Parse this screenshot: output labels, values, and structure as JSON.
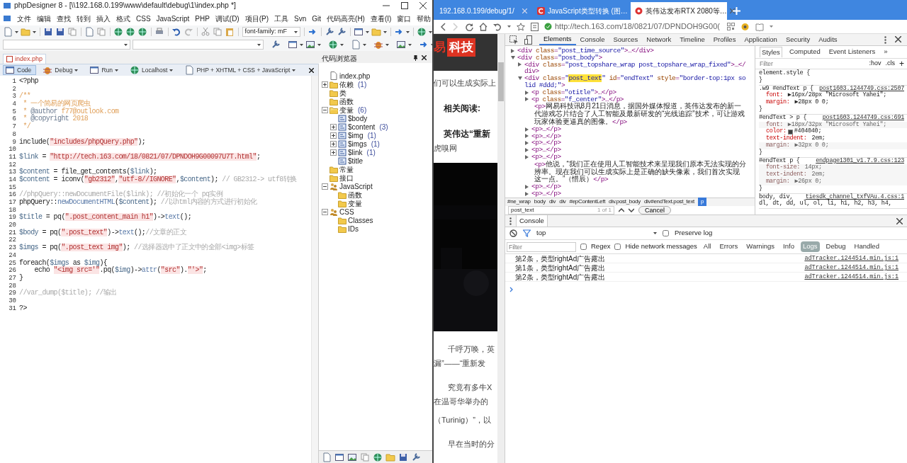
{
  "editor_window": {
    "title": "phpDesigner 8 - [\\\\192.168.0.199\\www\\default\\debug\\1\\index.php *]",
    "menu": [
      "文件",
      "编辑",
      "查找",
      "转到",
      "插入",
      "格式",
      "CSS",
      "JavaScript",
      "PHP",
      "调试(D)",
      "项目(P)",
      "工具",
      "Svn",
      "Git",
      "代码高亮(H)",
      "查看(I)",
      "窗口",
      "帮助"
    ],
    "font_combo": "font-family: mF",
    "file_tabs": [
      {
        "label": "index.php",
        "selected": true
      }
    ],
    "run_toolbar": [
      {
        "label": "Code",
        "selected": true,
        "dropdown": false
      },
      {
        "label": "Debug",
        "selected": false,
        "dropdown": true
      },
      {
        "label": "Run",
        "selected": false,
        "dropdown": true
      },
      {
        "label": "Localhost",
        "selected": false,
        "dropdown": true
      },
      {
        "label": "PHP + XHTML + CSS + JavaScript",
        "selected": false,
        "dropdown": true
      }
    ],
    "code_lines": [
      {
        "number": "1",
        "tokens": [
          {
            "kind": "plain",
            "text": "<?php"
          }
        ]
      },
      {
        "number": "2"
      },
      {
        "number": "3",
        "tokens": [
          {
            "kind": "doc",
            "text": "/**"
          }
        ]
      },
      {
        "number": "4",
        "tokens": [
          {
            "kind": "doc",
            "text": " * 一个简易的网页爬虫"
          }
        ]
      },
      {
        "number": "5",
        "tokens": [
          {
            "kind": "doc",
            "text": " * "
          },
          {
            "kind": "doctag",
            "text": "@author"
          },
          {
            "kind": "doc",
            "text": " f77@outlook.com"
          }
        ]
      },
      {
        "number": "6",
        "tokens": [
          {
            "kind": "doc",
            "text": " * "
          },
          {
            "kind": "doctag",
            "text": "@copyright"
          },
          {
            "kind": "doc",
            "text": " 2018"
          }
        ]
      },
      {
        "number": "7",
        "tokens": [
          {
            "kind": "doc",
            "text": " */"
          }
        ]
      },
      {
        "number": "8"
      },
      {
        "number": "9",
        "tokens": [
          {
            "kind": "plain",
            "text": "include("
          },
          {
            "kind": "string",
            "text": "\"includes/phpQuery.php\""
          },
          {
            "kind": "plain",
            "text": ");"
          }
        ]
      },
      {
        "number": "10"
      },
      {
        "number": "11",
        "tokens": [
          {
            "kind": "var",
            "text": "$link"
          },
          {
            "kind": "plain",
            "text": " = "
          },
          {
            "kind": "string",
            "text": "\"http://tech.163.com/18/0821/07/DPNDOH9G00097U7T.html\""
          },
          {
            "kind": "plain",
            "text": ";"
          }
        ]
      },
      {
        "number": "12"
      },
      {
        "number": "13",
        "tokens": [
          {
            "kind": "var",
            "text": "$content"
          },
          {
            "kind": "plain",
            "text": " = file_get_contents("
          },
          {
            "kind": "var",
            "text": "$link"
          },
          {
            "kind": "plain",
            "text": ");"
          }
        ]
      },
      {
        "number": "14",
        "tokens": [
          {
            "kind": "var",
            "text": "$content"
          },
          {
            "kind": "plain",
            "text": " = iconv("
          },
          {
            "kind": "string",
            "text": "\"gb2312\""
          },
          {
            "kind": "plain",
            "text": ","
          },
          {
            "kind": "string",
            "text": "\"utf-8//IGNORE\""
          },
          {
            "kind": "plain",
            "text": ","
          },
          {
            "kind": "var",
            "text": "$content"
          },
          {
            "kind": "plain",
            "text": ");"
          },
          {
            "kind": "comment",
            "text": " // GB2312-> utf8转换"
          }
        ]
      },
      {
        "number": "15"
      },
      {
        "number": "16",
        "tokens": [
          {
            "kind": "comment",
            "text": "//phpQuery::newDocumentFile($link); //初始化一个 pq实例"
          }
        ]
      },
      {
        "number": "17",
        "tokens": [
          {
            "kind": "plain",
            "text": "phpQuery::"
          },
          {
            "kind": "method",
            "text": "newDocumentHTML"
          },
          {
            "kind": "plain",
            "text": "("
          },
          {
            "kind": "var",
            "text": "$content"
          },
          {
            "kind": "plain",
            "text": ");"
          },
          {
            "kind": "comment",
            "text": " //以html内容的方式进行初始化"
          }
        ]
      },
      {
        "number": "18"
      },
      {
        "number": "19",
        "tokens": [
          {
            "kind": "var",
            "text": "$title"
          },
          {
            "kind": "plain",
            "text": " = pq("
          },
          {
            "kind": "string",
            "text": "\".post_content_main h1\""
          },
          {
            "kind": "plain",
            "text": ")->"
          },
          {
            "kind": "method",
            "text": "text"
          },
          {
            "kind": "plain",
            "text": "();"
          }
        ]
      },
      {
        "number": "20"
      },
      {
        "number": "21",
        "tokens": [
          {
            "kind": "var",
            "text": "$body"
          },
          {
            "kind": "plain",
            "text": " = pq("
          },
          {
            "kind": "string",
            "text": "\".post_text\""
          },
          {
            "kind": "plain",
            "text": ")->"
          },
          {
            "kind": "method",
            "text": "text"
          },
          {
            "kind": "plain",
            "text": "();"
          },
          {
            "kind": "comment",
            "text": "//文章的正文"
          }
        ]
      },
      {
        "number": "22"
      },
      {
        "number": "23",
        "tokens": [
          {
            "kind": "var",
            "text": "$imgs"
          },
          {
            "kind": "plain",
            "text": " = pq("
          },
          {
            "kind": "string",
            "text": "\".post_text img\""
          },
          {
            "kind": "plain",
            "text": ");"
          },
          {
            "kind": "comment",
            "text": " //选择器选中了正文中的全部<img>标签"
          }
        ]
      },
      {
        "number": "24"
      },
      {
        "number": "25",
        "tokens": [
          {
            "kind": "plain",
            "text": "foreach("
          },
          {
            "kind": "var",
            "text": "$imgs"
          },
          {
            "kind": "plain",
            "text": " as "
          },
          {
            "kind": "var",
            "text": "$img"
          },
          {
            "kind": "plain",
            "text": "){"
          }
        ]
      },
      {
        "number": "26",
        "tokens": [
          {
            "kind": "plain",
            "text": "    echo "
          },
          {
            "kind": "string",
            "text": "\"<img src='\""
          },
          {
            "kind": "plain",
            "text": ".pq("
          },
          {
            "kind": "var",
            "text": "$img"
          },
          {
            "kind": "plain",
            "text": ")->"
          },
          {
            "kind": "method",
            "text": "attr"
          },
          {
            "kind": "plain",
            "text": "("
          },
          {
            "kind": "string",
            "text": "\"src\""
          },
          {
            "kind": "plain",
            "text": ")."
          },
          {
            "kind": "string",
            "text": "\"'>\""
          },
          {
            "kind": "plain",
            "text": ";"
          }
        ]
      },
      {
        "number": "27",
        "tokens": [
          {
            "kind": "plain",
            "text": "}"
          }
        ]
      },
      {
        "number": "28"
      },
      {
        "number": "29",
        "tokens": [
          {
            "kind": "comment",
            "text": "//var_dump($title); //输出"
          }
        ]
      },
      {
        "number": "30"
      },
      {
        "number": "31",
        "tokens": [
          {
            "kind": "plain",
            "text": "?>"
          }
        ]
      }
    ],
    "code_browser": {
      "title": "代码浏览器",
      "tree": [
        {
          "label": "index.php",
          "kind": "file"
        },
        {
          "label": "依赖",
          "count": "(1)",
          "kind": "folder",
          "expanded": false
        },
        {
          "label": "类",
          "kind": "folder"
        },
        {
          "label": "函数",
          "kind": "folder"
        },
        {
          "label": "变量",
          "count": "(6)",
          "kind": "folder",
          "expanded": true,
          "children": [
            {
              "label": "$body",
              "kind": "var"
            },
            {
              "label": "$content",
              "count": "(3)",
              "kind": "var",
              "expanded": false
            },
            {
              "label": "$img",
              "count": "(1)",
              "kind": "var",
              "expanded": false
            },
            {
              "label": "$imgs",
              "count": "(1)",
              "kind": "var",
              "expanded": false
            },
            {
              "label": "$link",
              "count": "(1)",
              "kind": "var",
              "expanded": false
            },
            {
              "label": "$title",
              "kind": "var"
            }
          ]
        },
        {
          "label": "常量",
          "kind": "folder"
        },
        {
          "label": "接口",
          "kind": "folder"
        },
        {
          "label": "JavaScript",
          "kind": "group",
          "expanded": true,
          "children": [
            {
              "label": "函数",
              "kind": "folder"
            },
            {
              "label": "变量",
              "kind": "folder"
            }
          ]
        },
        {
          "label": "CSS",
          "kind": "group",
          "expanded": true,
          "children": [
            {
              "label": "Classes",
              "kind": "folder"
            },
            {
              "label": "IDs",
              "kind": "folder"
            }
          ]
        }
      ]
    }
  },
  "browser": {
    "tabs": [
      {
        "label": "192.168.0.199/debug/1/",
        "selected": false
      },
      {
        "label": "JavaScript类型转换 (图…",
        "selected": false
      },
      {
        "label": "英伟达发布RTX 2080等…",
        "selected": true
      }
    ],
    "url": "http://tech.163.com/18/0821/07/DPNDOH9G00(",
    "page": {
      "logo_text": "易",
      "logo_badge": "科技",
      "blocks": [
        {
          "kind": "text",
          "text": "们可以生成实际上"
        },
        {
          "kind": "bold",
          "text": "相关阅读:"
        },
        {
          "kind": "bold",
          "text": "英伟达“重新"
        },
        {
          "kind": "text",
          "text": "虎嗅网"
        },
        {
          "kind": "video"
        },
        {
          "kind": "indent",
          "text": "千呼万唤，英"
        },
        {
          "kind": "text",
          "text": "漏”——“重新发"
        },
        {
          "kind": "indent",
          "text": "究竟有多牛X"
        },
        {
          "kind": "text",
          "text": "在温哥华举办的"
        },
        {
          "kind": "text",
          "text": "（Turinig）”，以"
        },
        {
          "kind": "indent",
          "text": "早在当时的分"
        }
      ]
    }
  },
  "devtools": {
    "tabs": [
      {
        "label": "Elements",
        "selected": true
      },
      {
        "label": "Console",
        "selected": false
      },
      {
        "label": "Sources",
        "selected": false
      },
      {
        "label": "Network",
        "selected": false
      },
      {
        "label": "Timeline",
        "selected": false
      },
      {
        "label": "Profiles",
        "selected": false
      },
      {
        "label": "Application",
        "selected": false
      },
      {
        "label": "Security",
        "selected": false
      },
      {
        "label": "Audits",
        "selected": false
      }
    ],
    "dom_tree": [
      {
        "tokens": [
          {
            "kind": "tag",
            "text": "<div "
          },
          {
            "kind": "attr",
            "text": "class"
          },
          {
            "kind": "tag",
            "text": "="
          },
          {
            "kind": "value",
            "text": "\"post_time_source\""
          },
          {
            "kind": "tag",
            "text": ">…</div>"
          }
        ],
        "expanded": false
      },
      {
        "tokens": [
          {
            "kind": "tag",
            "text": "<div "
          },
          {
            "kind": "attr",
            "text": "class"
          },
          {
            "kind": "tag",
            "text": "="
          },
          {
            "kind": "value",
            "text": "\"post_body\""
          },
          {
            "kind": "tag",
            "text": ">"
          }
        ],
        "expanded": true,
        "children": [
          {
            "tokens": [
              {
                "kind": "tag",
                "text": "<div "
              },
              {
                "kind": "attr",
                "text": "class"
              },
              {
                "kind": "tag",
                "text": "="
              },
              {
                "kind": "value",
                "text": "\"post_topshare_wrap post_topshare_wrap_fixed\""
              },
              {
                "kind": "tag",
                "text": ">…</div>"
              }
            ],
            "expanded": false
          },
          {
            "tokens": [
              {
                "kind": "tag",
                "text": "<div "
              },
              {
                "kind": "attr",
                "text": "class"
              },
              {
                "kind": "tag",
                "text": "="
              },
              {
                "kind": "value",
                "text": "\""
              },
              {
                "kind": "match",
                "text": "post_text"
              },
              {
                "kind": "value",
                "text": "\""
              },
              {
                "kind": "attr",
                "text": " id"
              },
              {
                "kind": "tag",
                "text": "="
              },
              {
                "kind": "value",
                "text": "\"endText\""
              },
              {
                "kind": "attr",
                "text": " style"
              },
              {
                "kind": "tag",
                "text": "="
              },
              {
                "kind": "value",
                "text": "\"border-top:1px solid #ddd;\""
              },
              {
                "kind": "tag",
                "text": ">"
              }
            ],
            "expanded": true,
            "children": [
              {
                "tokens": [
                  {
                    "kind": "tag",
                    "text": "<p "
                  },
                  {
                    "kind": "attr",
                    "text": "class"
                  },
                  {
                    "kind": "tag",
                    "text": "="
                  },
                  {
                    "kind": "value",
                    "text": "\"otitle\""
                  },
                  {
                    "kind": "tag",
                    "text": ">…</p>"
                  }
                ],
                "expanded": false
              },
              {
                "tokens": [
                  {
                    "kind": "tag",
                    "text": "<p "
                  },
                  {
                    "kind": "attr",
                    "text": "class"
                  },
                  {
                    "kind": "tag",
                    "text": "="
                  },
                  {
                    "kind": "value",
                    "text": "\"f_center\""
                  },
                  {
                    "kind": "tag",
                    "text": ">…</p>"
                  }
                ],
                "expanded": false
              },
              {
                "tokens": [
                  {
                    "kind": "tag",
                    "text": "<p>"
                  },
                  {
                    "kind": "text",
                    "text": "网易科技讯8月21日消息，据国外媒体报道，英伟达发布的新一代游戏芯片结合了人工智能及最新研发的“光线追踪”技术，可让游戏玩家体验更逼真的图像。"
                  },
                  {
                    "kind": "tag",
                    "text": "</p>"
                  }
                ]
              },
              {
                "tokens": [
                  {
                    "kind": "tag",
                    "text": "<p>…</p>"
                  }
                ],
                "expanded": false
              },
              {
                "tokens": [
                  {
                    "kind": "tag",
                    "text": "<p>…</p>"
                  }
                ],
                "expanded": false
              },
              {
                "tokens": [
                  {
                    "kind": "tag",
                    "text": "<p>…</p>"
                  }
                ],
                "expanded": false
              },
              {
                "tokens": [
                  {
                    "kind": "tag",
                    "text": "<p>…</p>"
                  }
                ],
                "expanded": false
              },
              {
                "tokens": [
                  {
                    "kind": "tag",
                    "text": "<p>…</p>"
                  }
                ],
                "expanded": false
              },
              {
                "tokens": [
                  {
                    "kind": "tag",
                    "text": "<p>"
                  },
                  {
                    "kind": "text",
                    "text": "他说，“我们正在使用人工智能技术来呈现我们原本无法实现的分辨率。现在我们可以生成实际上是正确的缺失像素，我们首次实现这一点。”（惜辰）"
                  },
                  {
                    "kind": "tag",
                    "text": "</p>"
                  }
                ]
              },
              {
                "tokens": [
                  {
                    "kind": "tag",
                    "text": "<p>…</p>"
                  }
                ],
                "expanded": false
              },
              {
                "tokens": [
                  {
                    "kind": "tag",
                    "text": "<p>…</p>"
                  }
                ],
                "expanded": false
              }
            ]
          }
        ]
      }
    ],
    "breadcrumbs": [
      {
        "label": "#ne_wrap",
        "selected": false
      },
      {
        "label": "body",
        "selected": false
      },
      {
        "label": "div",
        "selected": false
      },
      {
        "label": "div",
        "selected": false
      },
      {
        "label": "#epContentLeft",
        "selected": false
      },
      {
        "label": "div.post_body",
        "selected": false
      },
      {
        "label": "div#endText.post_text",
        "selected": false
      },
      {
        "label": "p",
        "selected": true
      }
    ],
    "search": {
      "value": "post_text",
      "count": "1 of 1",
      "cancel": "Cancel"
    },
    "styles": {
      "tabs": [
        {
          "label": "Styles",
          "selected": true
        },
        {
          "label": "Computed",
          "selected": false
        },
        {
          "label": "Event Listeners",
          "selected": false
        },
        {
          "label": "»",
          "selected": false
        }
      ],
      "filter_placeholder": "Filter",
      "hov": ":hov",
      "cls": ".cls",
      "add": "+",
      "rules": [
        {
          "selector": "element.style {",
          "end": "}"
        },
        {
          "selector": ".w9 #endText p {",
          "source": "post1603.1244749.css:2507",
          "end": "}",
          "props": [
            {
              "name": "font:",
              "value": " ▶16px/28px \"Microsoft Yahei\";",
              "struck": false
            },
            {
              "name": "margin:",
              "value": " ▶28px 0 0;",
              "struck": false
            }
          ]
        },
        {
          "selector": "#endText > p {",
          "source": "post1603.1244749.css:691",
          "end": "}",
          "props": [
            {
              "name": "font:",
              "value": " ▶18px/32px \"Microsoft Yahei\";",
              "struck": true
            },
            {
              "name": "color:",
              "value": "#404040;",
              "struck": false,
              "color": "#404040"
            },
            {
              "name": "text-indent:",
              "value": " 2em;",
              "struck": false
            },
            {
              "name": "margin:",
              "value": " ▶32px 0 0;",
              "struck": true
            }
          ]
        },
        {
          "selector": "#endText p {",
          "source": "endpage1301_v1.7.9.css:123",
          "end": "}",
          "props": [
            {
              "name": "font-size:",
              "value": " 14px;",
              "struck": true
            },
            {
              "name": "text-indent:",
              "value": " 2em;",
              "struck": true
            },
            {
              "name": "margin:",
              "value": " ▶26px 0;",
              "struck": true
            }
          ]
        },
        {
          "selector": "body, div,",
          "source": "tiesdk_channel_txfVAu.4.css:1",
          "selector_more": "dl, dt, dd, ul, ol, li, h1, h2, h3, h4,"
        }
      ]
    },
    "console": {
      "title": "Console",
      "context": "top",
      "preserve_log": {
        "label": "Preserve log",
        "checked": false
      },
      "filter_placeholder": "Filter",
      "regex": {
        "label": "Regex",
        "checked": false
      },
      "hide_network": {
        "label": "Hide network messages",
        "checked": false
      },
      "levels": [
        {
          "label": "All",
          "selected": false
        },
        {
          "label": "Errors",
          "selected": false
        },
        {
          "label": "Warnings",
          "selected": false
        },
        {
          "label": "Info",
          "selected": false
        },
        {
          "label": "Logs",
          "selected": true
        },
        {
          "label": "Debug",
          "selected": false
        },
        {
          "label": "Handled",
          "selected": false
        }
      ],
      "messages": [
        {
          "text": "第2条，类型rightAd广告露出",
          "source": "adTracker.1244514.min.js:1"
        },
        {
          "text": "第1条，类型rightAd广告露出",
          "source": "adTracker.1244514.min.js:1"
        },
        {
          "text": "第2条，类型rightAd广告露出",
          "source": "adTracker.1244514.min.js:1"
        }
      ]
    }
  }
}
